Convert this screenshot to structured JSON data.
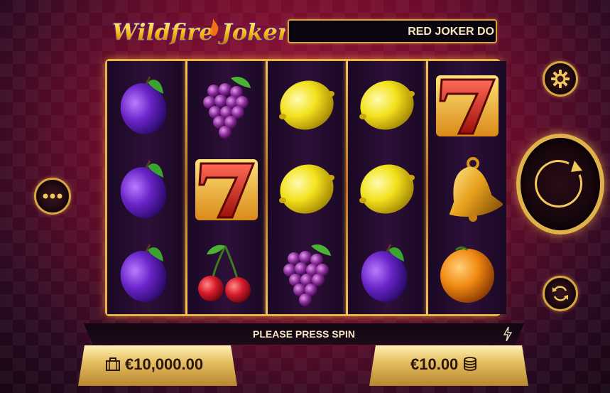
{
  "header": {
    "logo_text": "Wildfire Joker",
    "ticker_text": "RED JOKER DO"
  },
  "reels": [
    [
      "plum",
      "plum",
      "plum"
    ],
    [
      "grapes",
      "seven",
      "cherry"
    ],
    [
      "lemon",
      "lemon",
      "grapes"
    ],
    [
      "lemon",
      "lemon",
      "plum"
    ],
    [
      "seven",
      "bell",
      "orange"
    ]
  ],
  "message": {
    "text": "PLEASE PRESS SPIN",
    "icon": "lightning-icon"
  },
  "balance": {
    "value": "€10,000.00",
    "icon": "briefcase-icon"
  },
  "bet": {
    "value": "€10.00",
    "icon": "coins-icon"
  },
  "controls": {
    "menu_icon": "more-dots-icon",
    "settings_icon": "gear-icon",
    "spin_icon": "spin-arrow-icon",
    "autoplay_icon": "autoplay-icon"
  },
  "colors": {
    "gold": "#e0b04a",
    "background": "#6e0c2c",
    "plum": "#6a24c8",
    "grape": "#8c2d9c",
    "lemon": "#f3e21c",
    "seven": "#d7261e",
    "orange": "#f28a12"
  }
}
